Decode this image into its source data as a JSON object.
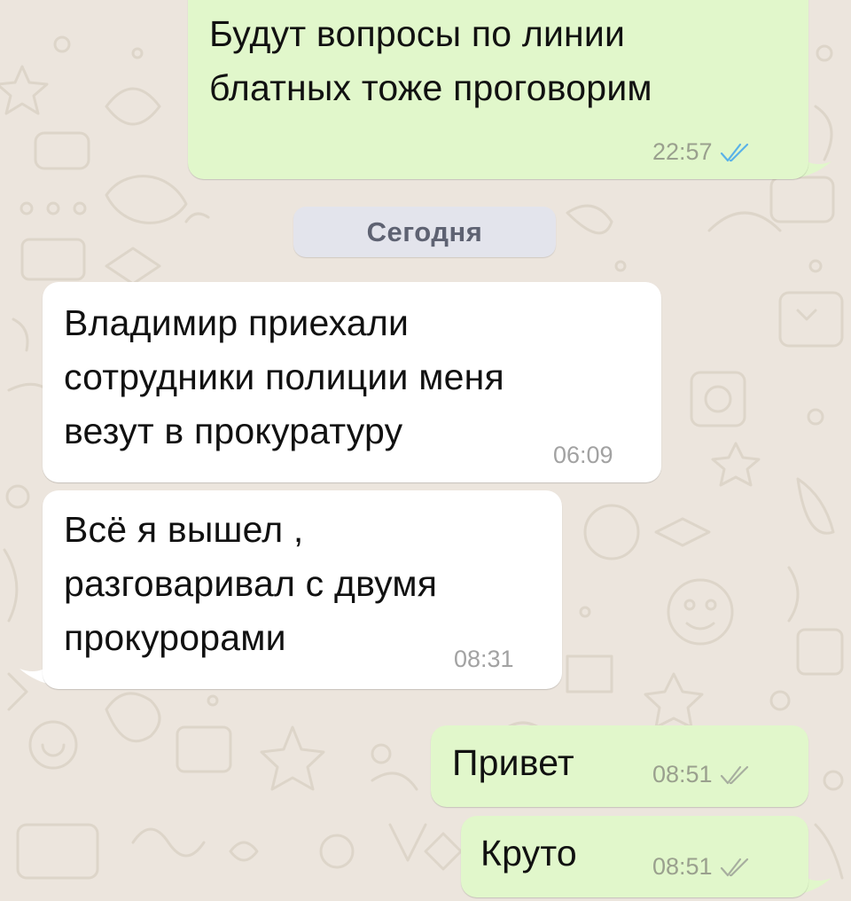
{
  "chat": {
    "date_separator": "Сегодня",
    "colors": {
      "background": "#ECE5DD",
      "outgoing_bubble": "#E1F7CB",
      "incoming_bubble": "#FFFFFF",
      "read_check": "#5AB2E8",
      "delivered_check": "#A7AE9F"
    },
    "messages": [
      {
        "direction": "outgoing",
        "text": "Будут вопросы по линии\nблатных тоже проговорим",
        "time": "22:57",
        "status_icon": "double-check-read-icon"
      },
      {
        "direction": "incoming",
        "text": "Владимир приехали\nсотрудники полиции меня\nвезут в прокуратуру",
        "time": "06:09"
      },
      {
        "direction": "incoming",
        "text": "Всё я вышел ,\nразговаривал с двумя\nпрокурорами",
        "time": "08:31"
      },
      {
        "direction": "outgoing",
        "text": "Привет",
        "time": "08:51",
        "status_icon": "double-check-delivered-icon"
      },
      {
        "direction": "outgoing",
        "text": "Круто",
        "time": "08:51",
        "status_icon": "double-check-delivered-icon"
      }
    ]
  }
}
